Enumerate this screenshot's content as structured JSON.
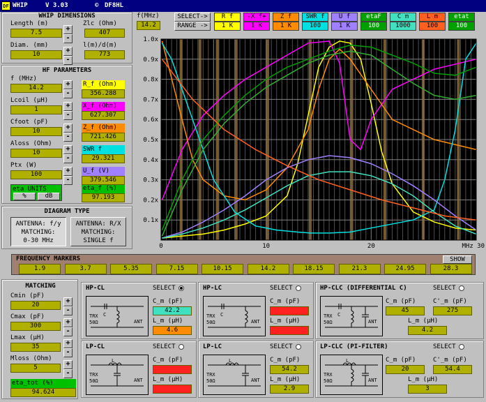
{
  "app": {
    "icon": "whip-icon",
    "title": "WHIP",
    "version": "V 3.03",
    "author_icon": "copyright-icon",
    "author": "DF8HL"
  },
  "whip": {
    "title": "WHIP DIMENSIONS",
    "length_label": "Length (m)",
    "length": "7.5",
    "diam_label": "Diam. (mm)",
    "diam": "10",
    "zlc_label": "Zlc (Ohm)",
    "zlc": "407",
    "ldm_label": "l(m)/d(m)",
    "ldm": "773"
  },
  "hf": {
    "title": "HF PARAMETERS",
    "rows": [
      {
        "label": "f (MHz)",
        "value": "14.2",
        "out_label": "R_f (Ohm)",
        "out": "356.288",
        "color": "#ffff00"
      },
      {
        "label": "Lcoil (µH)",
        "value": "1",
        "out_label": "X_f (Ohm)",
        "out": "627.307",
        "color": "#ff00ff"
      },
      {
        "label": "Cfoot (pF)",
        "value": "10",
        "out_label": "Z_f (Ohm)",
        "out": "721.426",
        "color": "#ff8c00"
      },
      {
        "label": "Aloss (Ohm)",
        "value": "10",
        "out_label": "SWR f",
        "out": "29.321",
        "color": "#00e0e0"
      },
      {
        "label": "Ptx (W)",
        "value": "100",
        "out_label": "U_f (V)",
        "out": "379.546",
        "color": "#a080ff"
      }
    ],
    "eta_units_label": "eta UNITS",
    "unit_pct": "%",
    "unit_db": "dB",
    "eta_label": "eta_f (%)",
    "eta": "97.193"
  },
  "diagram": {
    "title": "DIAGRAM TYPE",
    "opt1": [
      "ANTENNA: f/y",
      "MATCHING:",
      "0-30 MHz"
    ],
    "opt2": [
      "ANTENNA: R/X",
      "MATCHING:",
      "SINGLE f"
    ]
  },
  "fmhz": {
    "label": "f(MHz)",
    "value": "14.2"
  },
  "selector": {
    "select_label": "SELECT->",
    "range_label": "RANGE ->",
    "items": [
      {
        "name": "R f",
        "range": "1 K",
        "color": "#ffff00",
        "text": "#000"
      },
      {
        "name": "-X f+",
        "range": "1 K",
        "color": "#ff00ff",
        "text": "#000"
      },
      {
        "name": "Z f",
        "range": "1 K",
        "color": "#ff8c00",
        "text": "#000"
      },
      {
        "name": "SWR f",
        "range": "100",
        "color": "#00e0e0",
        "text": "#000"
      },
      {
        "name": "U f",
        "range": "1 K",
        "color": "#a080ff",
        "text": "#000"
      },
      {
        "name": "etaF",
        "range": "100",
        "color": "#00a000",
        "text": "#fff"
      },
      {
        "name": "C m",
        "range": "1000",
        "color": "#40e0c0",
        "text": "#000"
      },
      {
        "name": "L m",
        "range": "100",
        "color": "#ff6020",
        "text": "#000"
      },
      {
        "name": "etat",
        "range": "100",
        "color": "#00a000",
        "text": "#fff"
      }
    ]
  },
  "chart_data": {
    "type": "line",
    "xlim": [
      0,
      30
    ],
    "ylim": [
      0,
      1
    ],
    "xticks": [
      "0",
      "10",
      "20"
    ],
    "xunit": "MHz 30",
    "yticks": [
      "0.1x",
      "0.2x",
      "0.3x",
      "0.4x",
      "0.5x",
      "0.6x",
      "0.7x",
      "0.8x",
      "0.9x",
      "1.0x"
    ],
    "grid": true,
    "series": [
      {
        "color": "#ffff00",
        "x": [
          0.1,
          2,
          4,
          6,
          8,
          10,
          12,
          13,
          14,
          15,
          16,
          17,
          18,
          19,
          20,
          21,
          22,
          24,
          26,
          28,
          29,
          30
        ],
        "y": [
          0.01,
          0.02,
          0.03,
          0.05,
          0.08,
          0.12,
          0.22,
          0.38,
          0.62,
          0.86,
          0.96,
          0.99,
          0.98,
          0.9,
          0.68,
          0.44,
          0.28,
          0.14,
          0.09,
          0.06,
          0.055,
          0.05
        ]
      },
      {
        "color": "#ff00ff",
        "x": [
          0.1,
          2,
          4,
          6,
          8,
          10,
          12,
          14,
          16,
          17,
          18,
          19,
          20,
          22,
          26,
          30
        ],
        "y": [
          0.2,
          0.45,
          0.62,
          0.72,
          0.8,
          0.86,
          0.92,
          0.98,
          0.99,
          0.88,
          0.5,
          0.45,
          0.6,
          0.75,
          0.85,
          0.9
        ]
      },
      {
        "color": "#ff8c00",
        "x": [
          0.1,
          2,
          3,
          4,
          6,
          8,
          10,
          12,
          14,
          15,
          16,
          17,
          18,
          20,
          22,
          26,
          30
        ],
        "y": [
          0.99,
          0.6,
          0.4,
          0.3,
          0.22,
          0.2,
          0.25,
          0.36,
          0.55,
          0.75,
          0.9,
          0.95,
          0.9,
          0.75,
          0.6,
          0.5,
          0.45
        ]
      },
      {
        "color": "#00e0e0",
        "x": [
          0.1,
          1,
          2,
          3,
          4,
          5,
          7,
          9,
          11,
          13,
          14.2,
          16,
          18,
          20,
          24,
          26,
          27,
          28,
          29,
          30
        ],
        "y": [
          0.98,
          0.9,
          0.75,
          0.6,
          0.45,
          0.3,
          0.14,
          0.07,
          0.05,
          0.04,
          0.035,
          0.035,
          0.04,
          0.06,
          0.1,
          0.15,
          0.3,
          0.55,
          0.9,
          0.98
        ]
      },
      {
        "color": "#a080ff",
        "x": [
          0.1,
          2,
          4,
          6,
          8,
          10,
          12,
          14,
          16,
          18,
          20,
          22,
          24,
          26,
          28,
          30
        ],
        "y": [
          0.01,
          0.04,
          0.09,
          0.15,
          0.22,
          0.3,
          0.36,
          0.4,
          0.42,
          0.41,
          0.38,
          0.33,
          0.27,
          0.2,
          0.12,
          0.05
        ]
      },
      {
        "color": "#00a000",
        "x": [
          0.1,
          2,
          4,
          6,
          8,
          10,
          12,
          14,
          16,
          18,
          20,
          22,
          24,
          26,
          28,
          30
        ],
        "y": [
          0.05,
          0.3,
          0.5,
          0.62,
          0.72,
          0.8,
          0.86,
          0.9,
          0.94,
          0.97,
          0.96,
          0.92,
          0.88,
          0.83,
          0.82,
          0.86
        ]
      },
      {
        "color": "#40e0c0",
        "x": [
          0.1,
          2,
          4,
          6,
          8,
          10,
          12,
          14,
          16,
          18,
          20,
          22,
          24,
          26,
          28,
          30
        ],
        "y": [
          0.01,
          0.03,
          0.06,
          0.1,
          0.15,
          0.21,
          0.27,
          0.32,
          0.34,
          0.34,
          0.32,
          0.28,
          0.22,
          0.14,
          0.07,
          0.03
        ]
      },
      {
        "color": "#ff6020",
        "x": [
          0.1,
          3,
          6,
          9,
          12,
          15,
          18,
          21,
          24,
          27,
          30
        ],
        "y": [
          0.9,
          0.7,
          0.55,
          0.45,
          0.37,
          0.3,
          0.25,
          0.2,
          0.16,
          0.12,
          0.1
        ]
      },
      {
        "color": "#30b030",
        "x": [
          0.1,
          2,
          4,
          6,
          8,
          10,
          12,
          14,
          16,
          18,
          20,
          22,
          24,
          26,
          28,
          30
        ],
        "y": [
          0.02,
          0.25,
          0.45,
          0.58,
          0.68,
          0.76,
          0.82,
          0.88,
          0.92,
          0.94,
          0.92,
          0.85,
          0.78,
          0.72,
          0.7,
          0.72
        ]
      }
    ]
  },
  "markers": {
    "title": "FREQUENCY MARKERS",
    "show": "SHOW",
    "values": [
      "1.9",
      "3.7",
      "5.35",
      "7.15",
      "10.15",
      "14.2",
      "18.15",
      "21.3",
      "24.95",
      "28.3"
    ]
  },
  "matching": {
    "title": "MATCHING",
    "rows": [
      {
        "label": "Cmin (pF)",
        "value": "20"
      },
      {
        "label": "Cmax (pF)",
        "value": "300"
      },
      {
        "label": "Lmax (µH)",
        "value": "35"
      },
      {
        "label": "Mloss (Ohm)",
        "value": "5"
      }
    ],
    "eta_tot_label": "eta_tot (%)",
    "eta_tot": "94.624"
  },
  "circuits": [
    {
      "title": "HP-CL",
      "select": "SELECT",
      "on": true,
      "c_label": "C_m (pF)",
      "c": "42.2",
      "c_color": "#40e0c0",
      "l_label": "L_m (µH)",
      "l": "4.6",
      "l_color": "#ff8c00"
    },
    {
      "title": "HP-LC",
      "select": "SELECT",
      "on": false,
      "c_label": "C_m (pF)",
      "c": "",
      "c_color": "#ff2020",
      "l_label": "L_m (µH)",
      "l": "",
      "l_color": "#ff2020"
    },
    {
      "title": "HP-CLC (DIFFERENTIAL C)",
      "select": "SELECT",
      "on": false,
      "c_label": "C_m (pF)",
      "c": "45",
      "c2_label": "C'_m (pF)",
      "c2": "275",
      "l_label": "L_m (µH)",
      "l": "4.2"
    },
    {
      "title": "LP-CL",
      "select": "SELECT",
      "on": false,
      "c_label": "C_m (pF)",
      "c": "",
      "c_color": "#ff2020",
      "l_label": "L_m (µH)",
      "l": "",
      "l_color": "#ff2020"
    },
    {
      "title": "LP-LC",
      "select": "SELECT",
      "on": false,
      "c_label": "C_m (pF)",
      "c": "54.2",
      "c_color": "#b0b000",
      "l_label": "L_m (µH)",
      "l": "2.9",
      "l_color": "#b0b000"
    },
    {
      "title": "LP-CLC (PI-FILTER)",
      "select": "SELECT",
      "on": false,
      "c_label": "C_m (pF)",
      "c": "20",
      "c2_label": "C'_m (pF)",
      "c2": "54.4",
      "l_label": "L_m (µH)",
      "l": "3"
    }
  ],
  "schem": {
    "trx": "TRX",
    "ohm": "50Ω",
    "ant": "ANT",
    "c": "C",
    "l": "L",
    "cp": "C'"
  }
}
